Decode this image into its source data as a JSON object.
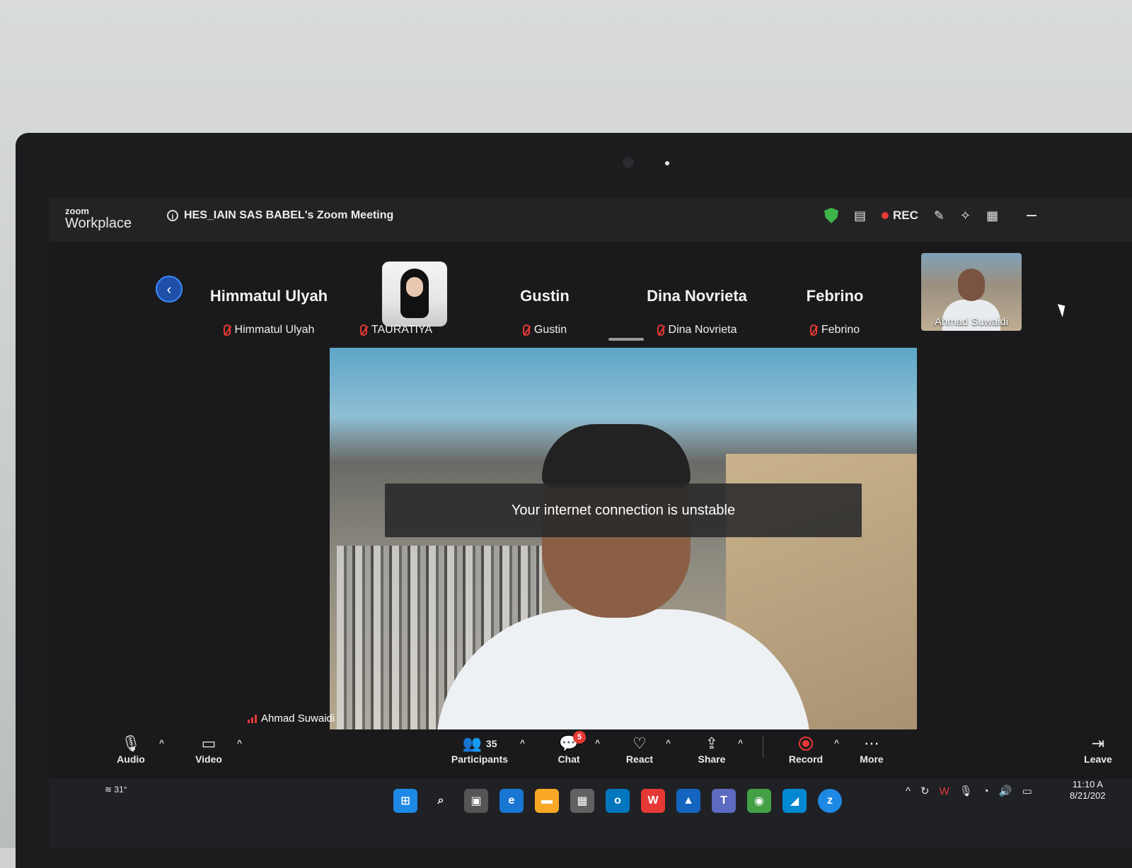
{
  "app": {
    "brand_small": "zoom",
    "brand_big": "Workplace",
    "meeting_title": "HES_IAIN SAS BABEL's Zoom Meeting"
  },
  "title_bar": {
    "rec_label": "REC"
  },
  "participants_strip": [
    {
      "name": "Himmatul Ulyah",
      "label": "Himmatul Ulyah"
    },
    {
      "name": "",
      "label": "TAURATIYA"
    },
    {
      "name": "Gustin",
      "label": "Gustin"
    },
    {
      "name": "Dina Novrieta",
      "label": "Dina Novrieta"
    },
    {
      "name": "Febrino",
      "label": "Febrino"
    },
    {
      "name": "",
      "label": "Ahmad Suwaidi"
    }
  ],
  "main_video": {
    "notice": "Your internet connection is unstable",
    "speaker": "Ahmad Suwaidi"
  },
  "toolbar": {
    "audio": "Audio",
    "video": "Video",
    "participants": "Participants",
    "participants_count": "35",
    "chat": "Chat",
    "chat_badge": "5",
    "react": "React",
    "share": "Share",
    "record": "Record",
    "more": "More",
    "leave": "Leave"
  },
  "taskbar": {
    "temperature": "31°",
    "time": "11:10 A",
    "date": "8/21/202"
  },
  "colors": {
    "accent": "#3d8bff",
    "rec_red": "#e53935",
    "shield_green": "#3cb54a"
  }
}
